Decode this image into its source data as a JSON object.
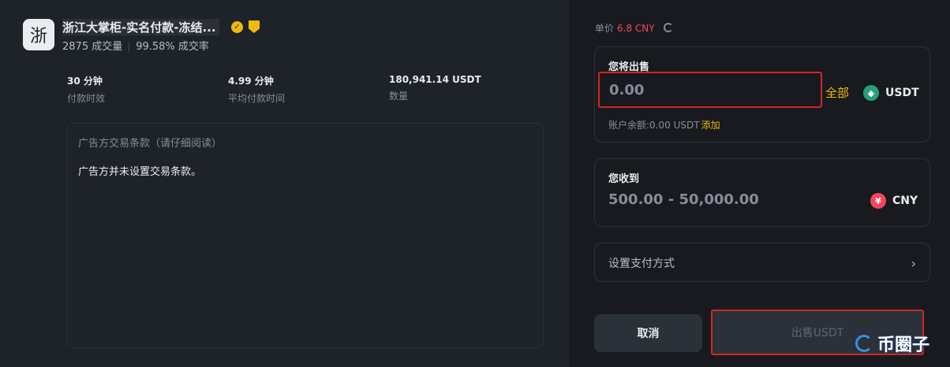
{
  "merchant": {
    "avatar_char": "浙",
    "name": "浙江大掌柜-实名付款-冻结...",
    "trades": "2875 成交量",
    "completion_rate": "99.58% 成交率",
    "verified_icon": "check-badge-icon",
    "shield_icon": "shield-icon"
  },
  "metrics": [
    {
      "value": "30 分钟",
      "label": "付款时效"
    },
    {
      "value": "4.99 分钟",
      "label": "平均付款时间"
    },
    {
      "value": "180,941.14 USDT",
      "label": "数量"
    }
  ],
  "terms": {
    "title": "广告方交易条款（请仔细阅读）",
    "body": "广告方并未设置交易条款。"
  },
  "price": {
    "label": "单价",
    "value": "6.8 CNY"
  },
  "sell": {
    "label": "您将出售",
    "placeholder": "0.00",
    "all_label": "全部",
    "coin": "USDT",
    "balance_label": "账户余额:0.00 USDT",
    "add_label": "添加"
  },
  "receive": {
    "label": "您收到",
    "range": "500.00 - 50,000.00",
    "coin": "CNY"
  },
  "payment": {
    "label": "设置支付方式",
    "chevron": "›"
  },
  "actions": {
    "cancel_label": "取消",
    "sell_label": "出售USDT"
  },
  "watermark": {
    "text": "币圈子"
  },
  "colors": {
    "accent": "#f0b90b",
    "price_red": "#f6465d",
    "highlight_border": "#d0281f",
    "usdt": "#26a17b"
  }
}
